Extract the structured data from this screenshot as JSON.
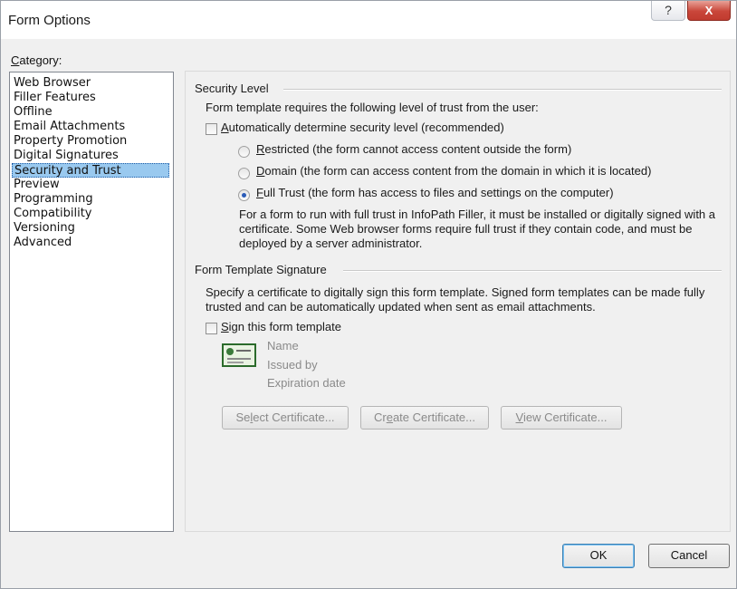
{
  "window": {
    "title": "Form Options",
    "help_glyph": "?",
    "close_glyph": "X"
  },
  "category": {
    "label_prefix": "",
    "label_accel": "C",
    "label_rest": "ategory:",
    "items": [
      "Web Browser",
      "Filler Features",
      "Offline",
      "Email Attachments",
      "Property Promotion",
      "Digital Signatures",
      "Security and Trust",
      "Preview",
      "Programming",
      "Compatibility",
      "Versioning",
      "Advanced"
    ],
    "selected": "Security and Trust"
  },
  "security": {
    "group_title": "Security Level",
    "intro": "Form template requires the following level of trust from the user:",
    "auto_accel": "A",
    "auto_rest": "utomatically determine security level (recommended)",
    "auto_checked": false,
    "restricted_accel": "R",
    "restricted_rest": "estricted (the form cannot access content outside the form)",
    "domain_accel": "D",
    "domain_rest": "omain (the form can access content from the domain in which it is located)",
    "full_accel": "F",
    "full_rest": "ull Trust (the form has access to files and settings on the computer)",
    "selected_level": "Full Trust",
    "note": "For a form to run with full trust in InfoPath Filler, it must be installed or digitally signed with a certificate. Some Web browser forms require full trust if they contain code, and must be deployed by a server administrator."
  },
  "signature": {
    "group_title": "Form Template Signature",
    "description": "Specify a certificate to digitally sign this form template. Signed form templates can be made fully trusted and can be automatically updated when sent as email attachments.",
    "sign_accel": "S",
    "sign_rest": "ign this form template",
    "sign_checked": false,
    "cert_name": "Name",
    "cert_issued": "Issued by",
    "cert_expiration": "Expiration date",
    "select_pre": "Se",
    "select_accel": "l",
    "select_post": "ect Certificate...",
    "create_pre": "Cr",
    "create_accel": "e",
    "create_post": "ate Certificate...",
    "view_accel": "V",
    "view_post": "iew Certificate..."
  },
  "footer": {
    "ok_label": "OK",
    "cancel_label": "Cancel"
  },
  "colors": {
    "selection": "#99c9ef",
    "close_button": "#c9463a",
    "ok_border": "#3c7fb1"
  }
}
